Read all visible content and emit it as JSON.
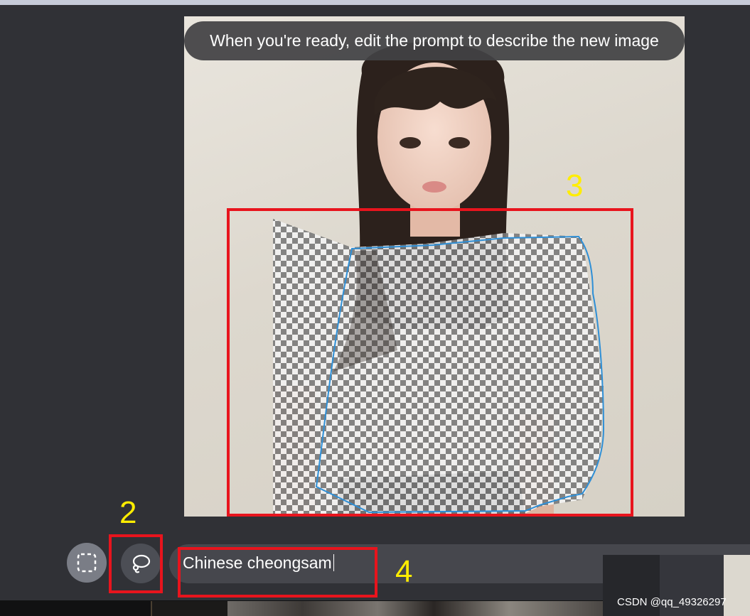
{
  "editor": {
    "tooltip": "When you're ready, edit the prompt to describe the new image",
    "prompt_value": "Chinese cheongsam"
  },
  "tools": [
    {
      "name": "rectangle-select",
      "icon": "dashed-rectangle-icon",
      "active": false
    },
    {
      "name": "lasso-select",
      "icon": "lasso-icon",
      "active": true
    }
  ],
  "annotations": [
    {
      "label": "2",
      "target": "lasso-select-button"
    },
    {
      "label": "3",
      "target": "edit-selection-area"
    },
    {
      "label": "4",
      "target": "prompt-input"
    }
  ],
  "watermark": "CSDN @qq_49326297",
  "colors": {
    "background": "#303136",
    "annotation_box": "#e8141d",
    "annotation_label": "#ffed00",
    "selection_outline": "#2f8fd6"
  }
}
